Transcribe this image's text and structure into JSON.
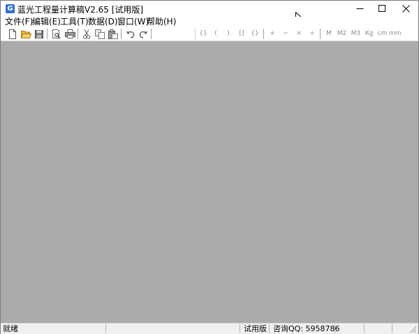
{
  "window": {
    "title": "蓝光工程量计算稿V2.65 [试用版]",
    "app_icon_glyph": "G",
    "controls": [
      "minimize-icon",
      "maximize-icon",
      "close-icon"
    ]
  },
  "menu": {
    "items": [
      {
        "label": "文件(F)"
      },
      {
        "label": "编辑(E)"
      },
      {
        "label": "工具(T)"
      },
      {
        "label": "数据(D)"
      },
      {
        "label": "窗口(W)"
      },
      {
        "label": "帮助(H)"
      }
    ]
  },
  "toolbar": {
    "icon_buttons": [
      "new-file-icon",
      "open-folder-icon",
      "save-icon",
      "print-preview-icon",
      "print-icon",
      "cut-icon",
      "copy-icon",
      "paste-icon",
      "undo-icon",
      "redo-icon"
    ],
    "text_buttons": {
      "braces_paren": "{}",
      "open_paren": "(",
      "close_paren": ")",
      "brackets": "[]",
      "braces": "{}",
      "plus": "+",
      "minus": "−",
      "times": "×",
      "divide": "÷",
      "unit_m": "M",
      "unit_m2": "M2",
      "unit_m3": "M3",
      "unit_kg": "Kg",
      "unit_cm": "cm",
      "unit_mm": "mm"
    }
  },
  "status": {
    "ready": "就绪",
    "edition": "试用版",
    "contact": "咨询QQ: 5958786"
  },
  "colors": {
    "mdi_background": "#ababab",
    "status_bar": "#f0f0f0",
    "toolbar_text": "#8a8a8a",
    "app_icon": "#2f6fd1"
  }
}
